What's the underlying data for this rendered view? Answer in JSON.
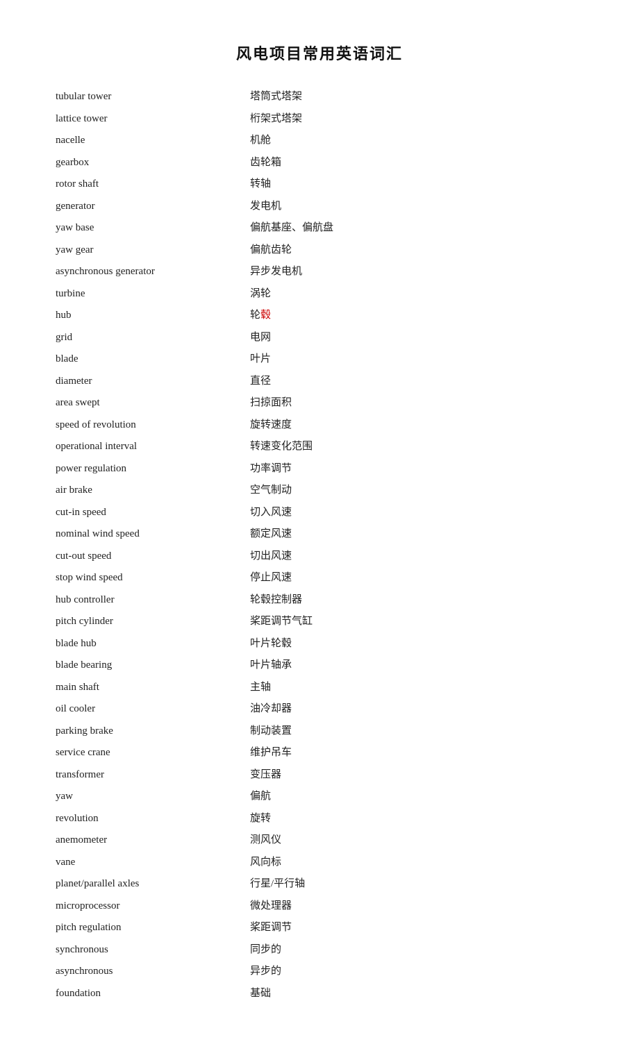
{
  "title": "风电项目常用英语词汇",
  "vocab": [
    {
      "en": "tubular tower",
      "zh": "塔筒式塔架"
    },
    {
      "en": "lattice tower",
      "zh": "桁架式塔架"
    },
    {
      "en": "nacelle",
      "zh": "机舱"
    },
    {
      "en": "gearbox",
      "zh": "齿轮箱"
    },
    {
      "en": "rotor shaft",
      "zh": "转轴"
    },
    {
      "en": "generator",
      "zh": "发电机"
    },
    {
      "en": "yaw base",
      "zh": "偏航基座、偏航盘"
    },
    {
      "en": "yaw gear",
      "zh": "偏航齿轮"
    },
    {
      "en": "asynchronous generator",
      "zh": "异步发电机"
    },
    {
      "en": "turbine",
      "zh": "涡轮"
    },
    {
      "en": "hub",
      "zh": "轮毂",
      "highlight_zh": true,
      "highlight_start": 1,
      "highlight_end": 2
    },
    {
      "en": "grid",
      "zh": "电网"
    },
    {
      "en": "blade",
      "zh": "叶片"
    },
    {
      "en": "diameter",
      "zh": "直径"
    },
    {
      "en": "area swept",
      "zh": "扫掠面积"
    },
    {
      "en": "speed of revolution",
      "zh": "旋转速度"
    },
    {
      "en": "operational interval",
      "zh": "转速变化范围"
    },
    {
      "en": "power regulation",
      "zh": "功率调节"
    },
    {
      "en": "air brake",
      "zh": "空气制动"
    },
    {
      "en": "cut-in speed",
      "zh": "切入风速"
    },
    {
      "en": "nominal wind speed",
      "zh": "额定风速"
    },
    {
      "en": "cut-out speed",
      "zh": "切出风速"
    },
    {
      "en": "stop wind speed",
      "zh": "停止风速"
    },
    {
      "en": "hub controller",
      "zh": "轮毂控制器"
    },
    {
      "en": "pitch cylinder",
      "zh": "桨距调节气缸"
    },
    {
      "en": "blade hub",
      "zh": "叶片轮毂"
    },
    {
      "en": "blade bearing",
      "zh": "叶片轴承"
    },
    {
      "en": "main shaft",
      "zh": "主轴"
    },
    {
      "en": "oil cooler",
      "zh": "油冷却器"
    },
    {
      "en": "parking brake",
      "zh": "制动装置"
    },
    {
      "en": "service crane",
      "zh": "维护吊车"
    },
    {
      "en": "transformer",
      "zh": "变压器"
    },
    {
      "en": "yaw",
      "zh": "偏航"
    },
    {
      "en": "revolution",
      "zh": "旋转"
    },
    {
      "en": "anemometer",
      "zh": "测风仪"
    },
    {
      "en": "vane",
      "zh": "风向标"
    },
    {
      "en": "planet/parallel axles",
      "zh": "行星/平行轴"
    },
    {
      "en": "microprocessor",
      "zh": "微处理器"
    },
    {
      "en": "pitch regulation",
      "zh": "桨距调节"
    },
    {
      "en": "synchronous",
      "zh": "同步的"
    },
    {
      "en": "asynchronous",
      "zh": "异步的"
    },
    {
      "en": "foundation",
      "zh": "基础"
    }
  ]
}
